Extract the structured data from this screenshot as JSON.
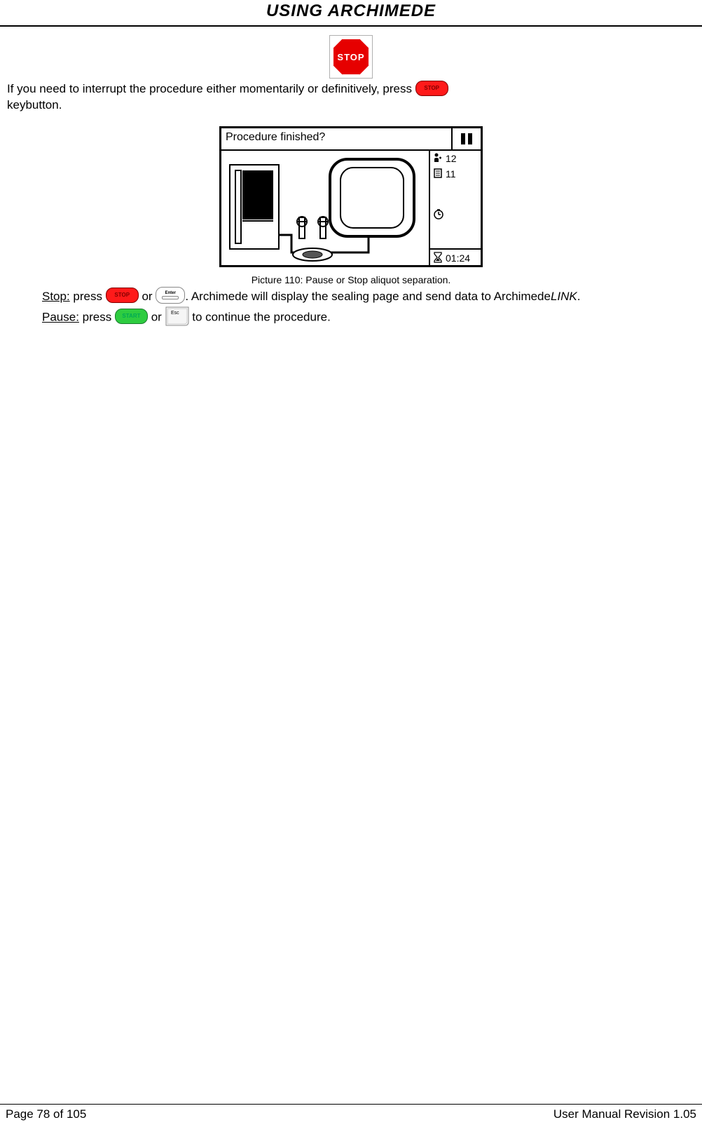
{
  "header": {
    "title": "USING ARCHIMEDE"
  },
  "stop_sign": {
    "label": "STOP"
  },
  "intro": {
    "line1_a": "If you need to interrupt the procedure either momentarily or definitively, press ",
    "line2": "keybutton."
  },
  "buttons": {
    "stop_label": "STOP",
    "start_label": "START",
    "enter_label": "Enter",
    "esc_label": "Esc"
  },
  "screen": {
    "title": "Procedure finished?",
    "side": {
      "patient_value": "12",
      "page_value": "11",
      "timer_value": "01:24"
    }
  },
  "caption": "Picture 110: Pause or Stop aliquot separation.",
  "body": {
    "stop_label": "Stop:",
    "stop_a": " press ",
    "stop_b": " or ",
    "stop_c": ". Archimede will display the sealing page and send data to Archimede",
    "stop_link": "LINK",
    "stop_d": ".",
    "pause_label": "Pause:",
    "pause_a": " press ",
    "pause_b": " or ",
    "pause_c": " to continue the procedure."
  },
  "footer": {
    "left": "Page 78 of 105",
    "right": "User Manual Revision 1.05"
  }
}
